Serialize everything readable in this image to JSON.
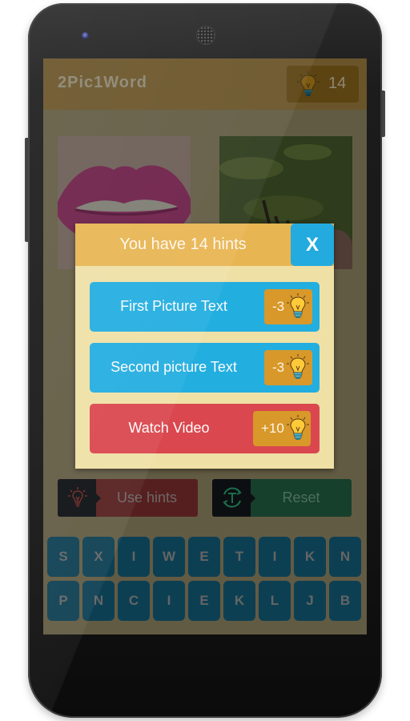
{
  "app": {
    "title": "2Pic1Word",
    "hint_count": "14",
    "hint_icon": "lightbulb-icon"
  },
  "pictures": [
    {
      "name": "lips",
      "description": "pink lips close-up"
    },
    {
      "name": "grass-twig",
      "description": "twig held over green grass"
    }
  ],
  "actions": {
    "use_hints_label": "Use hints",
    "use_hints_icon": "lightbulb-icon",
    "reset_label": "Reset",
    "reset_icon": "refresh-icon"
  },
  "letters": {
    "row1": [
      "S",
      "X",
      "I",
      "W",
      "E",
      "T",
      "I",
      "K",
      "N"
    ],
    "row2": [
      "P",
      "N",
      "C",
      "I",
      "E",
      "K",
      "L",
      "J",
      "B"
    ]
  },
  "dialog": {
    "title": "You have 14 hints",
    "close_label": "X",
    "options": [
      {
        "label": "First Picture Text",
        "cost": "-3",
        "color": "#23aee0"
      },
      {
        "label": "Second picture Text",
        "cost": "-3",
        "color": "#23aee0"
      },
      {
        "label": "Watch Video",
        "cost": "+10",
        "color": "#da474e"
      }
    ]
  },
  "colors": {
    "dialog_header": "#e8b553",
    "dialog_body": "#efe0a6",
    "close_button": "#23abdf",
    "cost_badge": "#d8982a",
    "tile": "#0d3f53"
  }
}
